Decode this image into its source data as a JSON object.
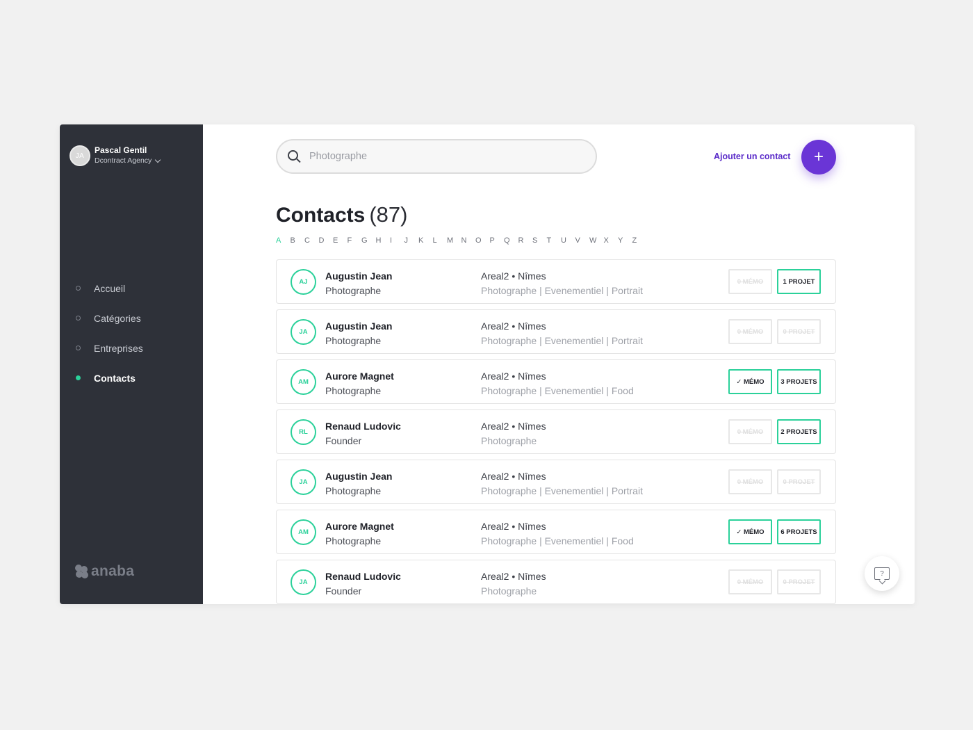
{
  "user": {
    "initials": "JA",
    "name": "Pascal Gentil",
    "organization": "Dcontract Agency"
  },
  "nav": [
    {
      "label": "Accueil",
      "active": false
    },
    {
      "label": "Catégories",
      "active": false
    },
    {
      "label": "Entreprises",
      "active": false
    },
    {
      "label": "Contacts",
      "active": true
    }
  ],
  "brand": {
    "name": "anaba"
  },
  "search": {
    "placeholder": "Photographe"
  },
  "actions": {
    "add_contact_label": "Ajouter un contact",
    "add_icon": "+"
  },
  "page": {
    "title": "Contacts",
    "count": "(87)"
  },
  "alphabet": [
    "A",
    "B",
    "C",
    "D",
    "E",
    "F",
    "G",
    "H",
    "I",
    "J",
    "K",
    "L",
    "M",
    "N",
    "O",
    "P",
    "Q",
    "R",
    "S",
    "T",
    "U",
    "V",
    "W",
    "X",
    "Y",
    "Z"
  ],
  "alphabet_active": "A",
  "contacts": [
    {
      "initials": "AJ",
      "name": "Augustin Jean",
      "role": "Photographe",
      "location": "Areal2 • Nîmes",
      "tags": "Photographe | Evenementiel | Portrait",
      "memo": "0 MÉMO",
      "memo_on": false,
      "projects": "1 PROJET",
      "projects_on": true
    },
    {
      "initials": "JA",
      "name": "Augustin Jean",
      "role": "Photographe",
      "location": "Areal2 • Nîmes",
      "tags": "Photographe | Evenementiel | Portrait",
      "memo": "0 MÉMO",
      "memo_on": false,
      "projects": "0 PROJET",
      "projects_on": false
    },
    {
      "initials": "AM",
      "name": "Aurore Magnet",
      "role": "Photographe",
      "location": "Areal2 • Nîmes",
      "tags": "Photographe | Evenementiel | Food",
      "memo": "✓ MÉMO",
      "memo_on": true,
      "projects": "3 PROJETS",
      "projects_on": true
    },
    {
      "initials": "RL",
      "name": "Renaud Ludovic",
      "role": "Founder",
      "location": "Areal2 • Nîmes",
      "tags": "Photographe",
      "memo": "0 MÉMO",
      "memo_on": false,
      "projects": "2 PROJETS",
      "projects_on": true
    },
    {
      "initials": "JA",
      "name": "Augustin Jean",
      "role": "Photographe",
      "location": "Areal2 • Nîmes",
      "tags": "Photographe | Evenementiel | Portrait",
      "memo": "0 MÉMO",
      "memo_on": false,
      "projects": "0 PROJET",
      "projects_on": false
    },
    {
      "initials": "AM",
      "name": "Aurore Magnet",
      "role": "Photographe",
      "location": "Areal2 • Nîmes",
      "tags": "Photographe | Evenementiel | Food",
      "memo": "✓ MÉMO",
      "memo_on": true,
      "projects": "6 PROJETS",
      "projects_on": true
    },
    {
      "initials": "JA",
      "name": "Renaud Ludovic",
      "role": "Founder",
      "location": "Areal2 • Nîmes",
      "tags": "Photographe",
      "memo": "0 MÉMO",
      "memo_on": false,
      "projects": "0 PROJET",
      "projects_on": false
    }
  ],
  "help": {
    "icon": "?"
  },
  "colors": {
    "accent": "#2bd19a",
    "primary": "#6a35d6",
    "sidebar": "#2e3139"
  }
}
